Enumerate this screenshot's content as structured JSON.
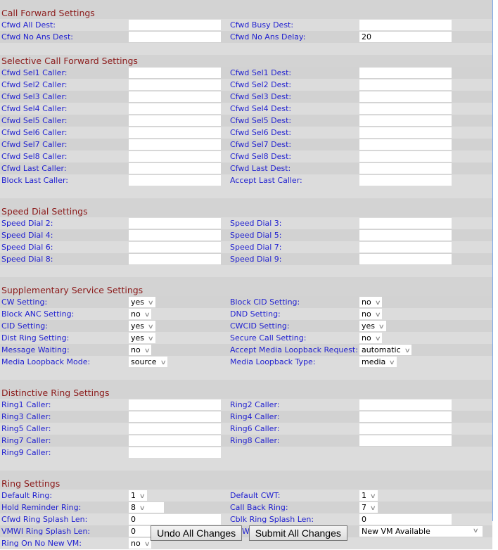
{
  "sections": {
    "call_forward": {
      "title": "Call Forward Settings",
      "rows": [
        {
          "left": {
            "label": "Cfwd All Dest:",
            "value": ""
          },
          "right": {
            "label": "Cfwd Busy Dest:",
            "value": ""
          }
        },
        {
          "left": {
            "label": "Cfwd No Ans Dest:",
            "value": ""
          },
          "right": {
            "label": "Cfwd No Ans Delay:",
            "value": "20"
          }
        }
      ]
    },
    "selective_call_forward": {
      "title": "Selective Call Forward Settings",
      "rows": [
        {
          "left": {
            "label": "Cfwd Sel1 Caller:",
            "value": ""
          },
          "right": {
            "label": "Cfwd Sel1 Dest:",
            "value": ""
          }
        },
        {
          "left": {
            "label": "Cfwd Sel2 Caller:",
            "value": ""
          },
          "right": {
            "label": "Cfwd Sel2 Dest:",
            "value": ""
          }
        },
        {
          "left": {
            "label": "Cfwd Sel3 Caller:",
            "value": ""
          },
          "right": {
            "label": "Cfwd Sel3 Dest:",
            "value": ""
          }
        },
        {
          "left": {
            "label": "Cfwd Sel4 Caller:",
            "value": ""
          },
          "right": {
            "label": "Cfwd Sel4 Dest:",
            "value": ""
          }
        },
        {
          "left": {
            "label": "Cfwd Sel5 Caller:",
            "value": ""
          },
          "right": {
            "label": "Cfwd Sel5 Dest:",
            "value": ""
          }
        },
        {
          "left": {
            "label": "Cfwd Sel6 Caller:",
            "value": ""
          },
          "right": {
            "label": "Cfwd Sel6 Dest:",
            "value": ""
          }
        },
        {
          "left": {
            "label": "Cfwd Sel7 Caller:",
            "value": ""
          },
          "right": {
            "label": "Cfwd Sel7 Dest:",
            "value": ""
          }
        },
        {
          "left": {
            "label": "Cfwd Sel8 Caller:",
            "value": ""
          },
          "right": {
            "label": "Cfwd Sel8 Dest:",
            "value": ""
          }
        },
        {
          "left": {
            "label": "Cfwd Last Caller:",
            "value": ""
          },
          "right": {
            "label": "Cfwd Last Dest:",
            "value": ""
          }
        },
        {
          "left": {
            "label": "Block Last Caller:",
            "value": ""
          },
          "right": {
            "label": "Accept Last Caller:",
            "value": ""
          }
        }
      ]
    },
    "speed_dial": {
      "title": "Speed Dial Settings",
      "rows": [
        {
          "left": {
            "label": "Speed Dial 2:",
            "value": ""
          },
          "right": {
            "label": "Speed Dial 3:",
            "value": ""
          }
        },
        {
          "left": {
            "label": "Speed Dial 4:",
            "value": ""
          },
          "right": {
            "label": "Speed Dial 5:",
            "value": ""
          }
        },
        {
          "left": {
            "label": "Speed Dial 6:",
            "value": ""
          },
          "right": {
            "label": "Speed Dial 7:",
            "value": ""
          }
        },
        {
          "left": {
            "label": "Speed Dial 8:",
            "value": ""
          },
          "right": {
            "label": "Speed Dial 9:",
            "value": ""
          }
        }
      ]
    },
    "supplementary": {
      "title": "Supplementary Service Settings",
      "rows": [
        {
          "left": {
            "label": "CW Setting:",
            "value": "yes"
          },
          "right": {
            "label": "Block CID Setting:",
            "value": "no"
          }
        },
        {
          "left": {
            "label": "Block ANC Setting:",
            "value": "no"
          },
          "right": {
            "label": "DND Setting:",
            "value": "no"
          }
        },
        {
          "left": {
            "label": "CID Setting:",
            "value": "yes"
          },
          "right": {
            "label": "CWCID Setting:",
            "value": "yes"
          }
        },
        {
          "left": {
            "label": "Dist Ring Setting:",
            "value": "yes"
          },
          "right": {
            "label": "Secure Call Setting:",
            "value": "no"
          }
        },
        {
          "left": {
            "label": "Message Waiting:",
            "value": "no"
          },
          "right": {
            "label": "Accept Media Loopback Request:",
            "value": "automatic"
          }
        },
        {
          "left": {
            "label": "Media Loopback Mode:",
            "value": "source"
          },
          "right": {
            "label": "Media Loopback Type:",
            "value": "media"
          }
        }
      ]
    },
    "distinctive_ring": {
      "title": "Distinctive Ring Settings",
      "rows": [
        {
          "left": {
            "label": "Ring1 Caller:",
            "value": ""
          },
          "right": {
            "label": "Ring2 Caller:",
            "value": ""
          }
        },
        {
          "left": {
            "label": "Ring3 Caller:",
            "value": ""
          },
          "right": {
            "label": "Ring4 Caller:",
            "value": ""
          }
        },
        {
          "left": {
            "label": "Ring5 Caller:",
            "value": ""
          },
          "right": {
            "label": "Ring6 Caller:",
            "value": ""
          }
        },
        {
          "left": {
            "label": "Ring7 Caller:",
            "value": ""
          },
          "right": {
            "label": "Ring8 Caller:",
            "value": ""
          }
        },
        {
          "left": {
            "label": "Ring9 Caller:",
            "value": ""
          }
        }
      ]
    },
    "ring": {
      "title": "Ring Settings",
      "rows": [
        {
          "left": {
            "label": "Default Ring:",
            "value": "1"
          },
          "right": {
            "label": "Default CWT:",
            "value": "1"
          }
        },
        {
          "left": {
            "label": "Hold Reminder Ring:",
            "value": "8"
          },
          "right": {
            "label": "Call Back Ring:",
            "value": "7"
          }
        },
        {
          "left": {
            "label": "Cfwd Ring Splash Len:",
            "value": "0"
          },
          "right": {
            "label": "Cblk Ring Splash Len:",
            "value": "0"
          }
        },
        {
          "left": {
            "label": "VMWI Ring Splash Len:",
            "value": "0"
          },
          "right": {
            "label": "VMWI Ring Policy:",
            "value": "New VM Available"
          }
        },
        {
          "left": {
            "label": "Ring On No New VM:",
            "value": "no"
          }
        }
      ]
    }
  },
  "buttons": {
    "undo": "Undo All Changes",
    "submit": "Submit All Changes"
  },
  "icons": {
    "dropdown": "chevron-down-icon"
  }
}
